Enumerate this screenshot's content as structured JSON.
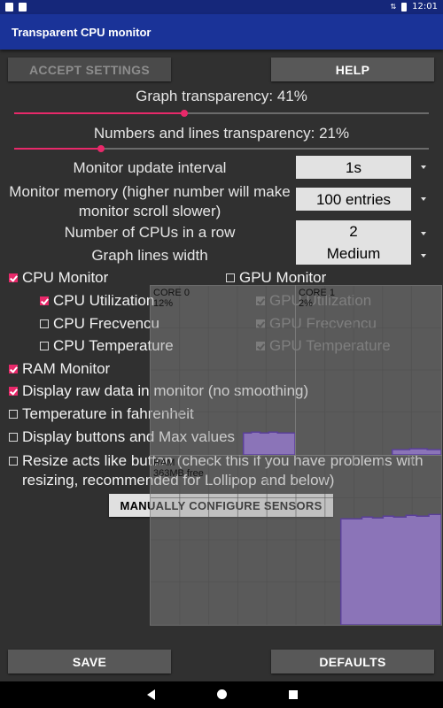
{
  "statusbar": {
    "time": "12:01"
  },
  "app": {
    "title": "Transparent CPU monitor"
  },
  "buttons": {
    "accept": "ACCEPT SETTINGS",
    "help": "HELP",
    "manual": "MANUALLY CONFIGURE SENSORS",
    "save": "SAVE",
    "defaults": "DEFAULTS"
  },
  "sliders": {
    "graph_label": "Graph transparency: 41%",
    "graph_value": 41,
    "numbers_label": "Numbers and lines transparency: 21%",
    "numbers_value": 21
  },
  "settings": {
    "update_interval_label": "Monitor update interval",
    "update_interval_value": "1s",
    "memory_label": "Monitor memory (higher number will make monitor scroll slower)",
    "memory_value": "100 entries",
    "cpus_row_label": "Number of CPUs in a row",
    "cpus_row_value": "2",
    "line_width_label": "Graph lines width",
    "line_width_value": "Medium"
  },
  "checkboxes": {
    "cpu_monitor": "CPU Monitor",
    "gpu_monitor": "GPU Monitor",
    "cpu_utilization": "CPU Utilization",
    "cpu_frequency": "CPU Frecvencu",
    "cpu_temperature": "CPU Temperature",
    "gpu_utilization": "GPU Utilization",
    "gpu_frequency": "GPU Frecvencu",
    "gpu_temperature": "GPU Temperature",
    "ram_monitor": "RAM Monitor",
    "raw_data": "Display raw data in monitor (no smoothing)",
    "fahrenheit": "Temperature in fahrenheit",
    "buttons_max": "Display buttons and Max values",
    "resize": "Resize acts like button (check this if you have problems with resizing, recommended for Lollipop and below)"
  },
  "monitors": {
    "core0_label": "CORE 0",
    "core0_value": "12%",
    "core1_label": "CORE 1",
    "core1_value": "2%",
    "ram_label": "RAM",
    "ram_value": "363MB free"
  },
  "colors": {
    "accent": "#e8296a",
    "app_bar": "#1a3398",
    "graph_fill": "#8b74b8",
    "graph_line": "#5a3f9a"
  }
}
